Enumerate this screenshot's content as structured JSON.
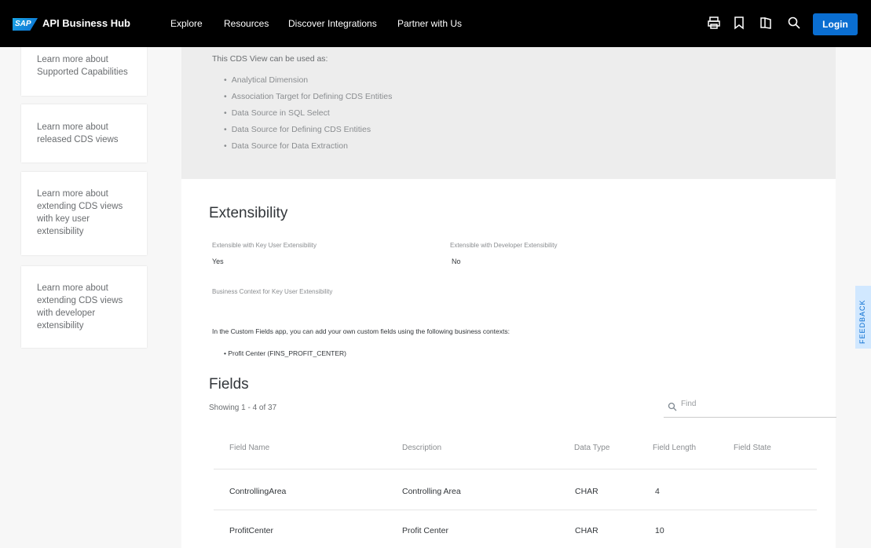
{
  "header": {
    "logo_text": "SAP",
    "brand": "API Business Hub",
    "nav": [
      "Explore",
      "Resources",
      "Discover Integrations",
      "Partner with Us"
    ],
    "icons": [
      "printer-icon",
      "bookmark-icon",
      "book-icon",
      "search-icon"
    ],
    "login_label": "Login"
  },
  "sidebar": {
    "cards": [
      {
        "label": "Learn more about Supported Capabilities"
      },
      {
        "label": "Learn more about released CDS views"
      },
      {
        "label": "Learn more about extending CDS views with key user extensibility"
      },
      {
        "label": "Learn more about extending CDS views with developer extensibility"
      }
    ]
  },
  "usage": {
    "intro": "This CDS View can be used as:",
    "items": [
      "Analytical Dimension",
      "Association Target for Defining CDS Entities",
      "Data Source in SQL Select",
      "Data Source for Defining CDS Entities",
      "Data Source for Data Extraction"
    ]
  },
  "extensibility": {
    "title": "Extensibility",
    "key_user_label": "Extensible with Key User Extensibility",
    "key_user_value": "Yes",
    "developer_label": "Extensible with Developer Extensibility",
    "developer_value": "No",
    "business_context_label": "Business Context for Key User Extensibility",
    "business_context_desc": "In the Custom Fields app, you can add your own custom fields using the following business contexts:",
    "business_context_item": "Profit Center (FINS_PROFIT_CENTER)"
  },
  "fields": {
    "title": "Fields",
    "showing": "Showing 1 - 4 of 37",
    "find_placeholder": "Find",
    "columns": [
      "Field Name",
      "Description",
      "Data Type",
      "Field Length",
      "Field State"
    ],
    "rows": [
      [
        "ControllingArea",
        "Controlling Area",
        "CHAR",
        "4",
        ""
      ],
      [
        "ProfitCenter",
        "Profit Center",
        "CHAR",
        "10",
        ""
      ]
    ]
  },
  "feedback_label": "FEEDBACK",
  "colors": {
    "accent": "#0a6ed1",
    "topbar": "#000000",
    "feedback_bg": "#d1e8ff"
  }
}
